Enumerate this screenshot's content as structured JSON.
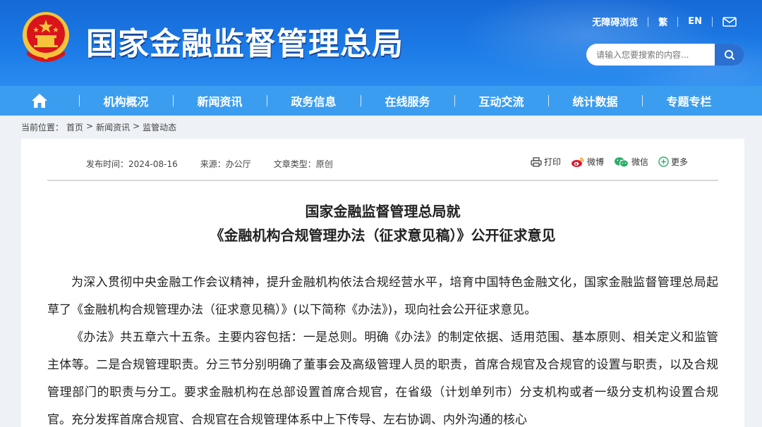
{
  "header": {
    "site_title": "国家金融监督管理总局",
    "top_links": [
      "无障碍浏览",
      "繁",
      "EN"
    ],
    "search_placeholder": "请输入您要搜索的内容..."
  },
  "nav": {
    "items": [
      "机构概况",
      "新闻资讯",
      "政务信息",
      "在线服务",
      "互动交流",
      "统计数据",
      "专题专栏"
    ]
  },
  "breadcrumb": {
    "label": "当前位置：",
    "path": [
      "首页",
      "新闻资讯",
      "监管动态"
    ],
    "sep": ">"
  },
  "meta": {
    "date": "发布时间：2024-08-16",
    "source": "来源：办公厅",
    "type": "文章类型：原创"
  },
  "share": {
    "print": "打印",
    "weibo": "微博",
    "wechat": "微信",
    "more": "更多"
  },
  "article": {
    "title_line1": "国家金融监督管理总局就",
    "title_line2": "《金融机构合规管理办法（征求意见稿）》公开征求意见",
    "p1": "为深入贯彻中央金融工作会议精神，提升金融机构依法合规经营水平，培育中国特色金融文化，国家金融监督管理总局起草了《金融机构合规管理办法（征求意见稿）》(以下简称《办法》)，现向社会公开征求意见。",
    "p2": "《办法》共五章六十五条。主要内容包括：一是总则。明确《办法》的制定依据、适用范围、基本原则、相关定义和监管主体等。二是合规管理职责。分三节分别明确了董事会及高级管理人员的职责，首席合规官及合规官的设置与职责，以及合规管理部门的职责与分工。要求金融机构在总部设置首席合规官，在省级（计划单列市）分支机构或者一级分支机构设置合规官。充分发挥首席合规官、合规官在合规管理体系中上下传导、左右协调、内外沟通的核心"
  },
  "colors": {
    "header_blue": "#1b7ae6",
    "nav_blue": "#3b9df0",
    "emblem_red": "#d9141b",
    "emblem_gold": "#f6c43b"
  }
}
